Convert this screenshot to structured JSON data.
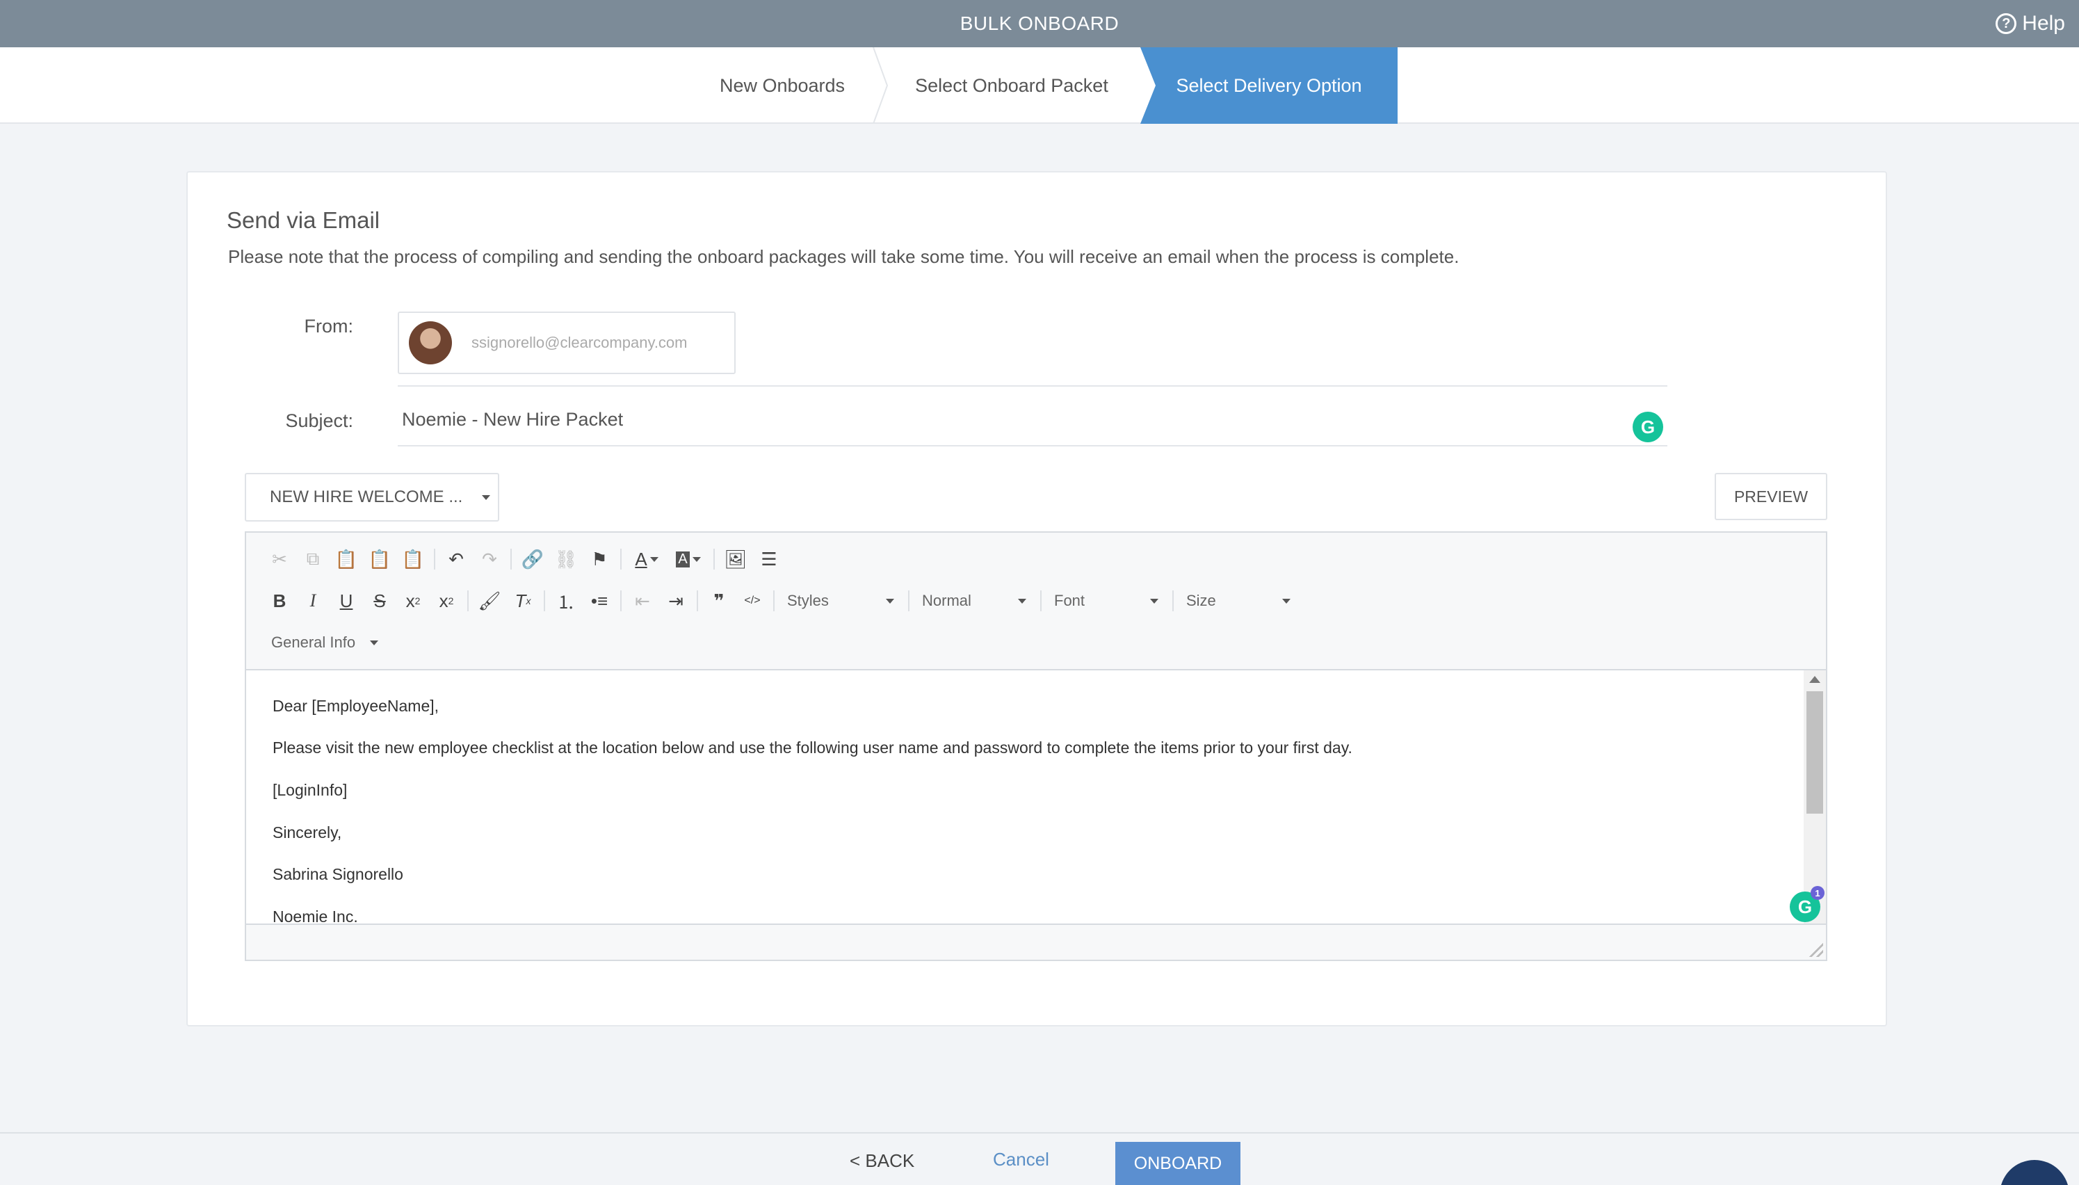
{
  "header": {
    "title": "BULK ONBOARD",
    "help_label": "Help",
    "help_icon": "?"
  },
  "steps": [
    {
      "label": "New Onboards",
      "active": false
    },
    {
      "label": "Select Onboard Packet",
      "active": false
    },
    {
      "label": "Select Delivery Option",
      "active": true
    }
  ],
  "card": {
    "title": "Send via Email",
    "note": "Please note that the process of compiling and sending the onboard packages will take some time. You will receive an email when the process is complete."
  },
  "form": {
    "from_label": "From:",
    "from_email": "ssignorello@clearcompany.com",
    "subject_label": "Subject:",
    "subject_value": "Noemie - New Hire Packet"
  },
  "template_select": {
    "value": "NEW HIRE WELCOME ..."
  },
  "preview_label": "PREVIEW",
  "toolbar": {
    "row1": [
      "cut-icon",
      "copy-icon",
      "paste-icon",
      "paste-text-icon",
      "paste-word-icon",
      "undo-icon",
      "redo-icon",
      "link-icon",
      "unlink-icon",
      "anchor-flag-icon",
      "text-color-icon",
      "bg-color-icon",
      "image-icon",
      "horizontal-rule-icon"
    ],
    "row2_format": [
      "bold",
      "italic",
      "underline",
      "strikethrough",
      "subscript",
      "superscript"
    ],
    "styles_label": "Styles",
    "format_label": "Normal",
    "font_label": "Font",
    "size_label": "Size",
    "general_info_label": "General Info"
  },
  "editor": {
    "lines": [
      "Dear [EmployeeName],",
      "Please visit the new employee checklist at the location below and use the following user name and password to complete the items prior to your first day.",
      "[LoginInfo]",
      "Sincerely,",
      "Sabrina Signorello",
      "Noemie Inc."
    ],
    "grammarly_badge": "1"
  },
  "footer": {
    "back_label": "< BACK",
    "cancel_label": "Cancel",
    "onboard_label": "ONBOARD"
  },
  "colors": {
    "topbar": "#7c8b98",
    "active_step": "#4a90d0",
    "primary_button": "#5b8fd0",
    "grammarly": "#15c39a"
  }
}
